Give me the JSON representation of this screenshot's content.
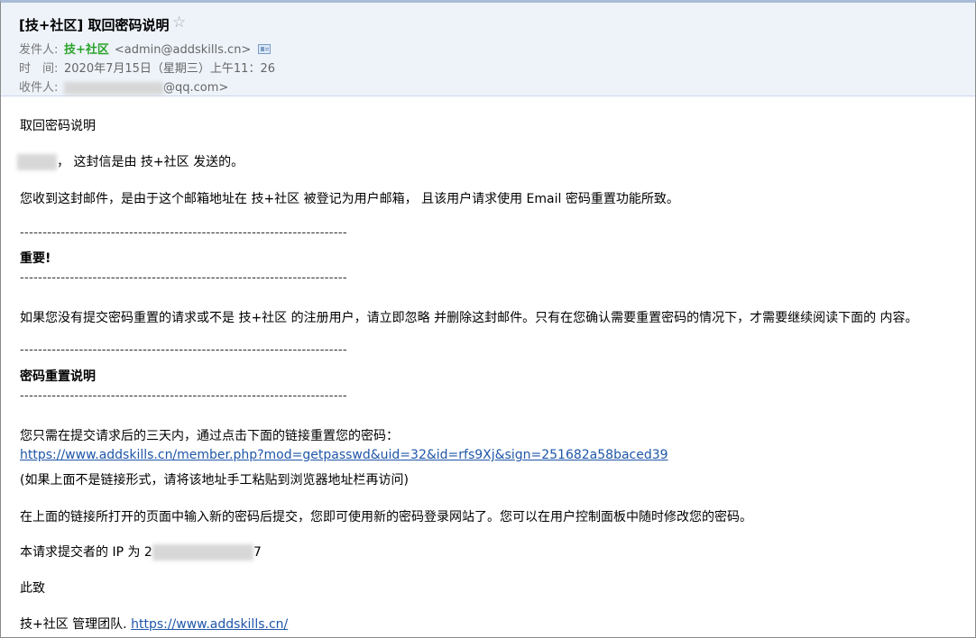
{
  "header": {
    "subject": "[技+社区] 取回密码说明",
    "star_icon": "star-outline-icon",
    "from_label": "发件人:",
    "from_name": "技+社区",
    "from_addr": "<admin@addskills.cn>",
    "card_icon": "address-card-icon",
    "time_label": "时　间:",
    "time_value": "2020年7月15日（星期三）上午11：26",
    "to_label": "收件人:",
    "to_suffix": "@qq.com>"
  },
  "body": {
    "title": "取回密码说明",
    "greeting_suffix": "， 这封信是由 技+社区 发送的。",
    "reason": "您收到这封邮件，是由于这个邮箱地址在 技+社区 被登记为用户邮箱， 且该用户请求使用 Email 密码重置功能所致。",
    "divider": "------------------------------------------------------------------------",
    "important_heading": "重要!",
    "warning": "如果您没有提交密码重置的请求或不是 技+社区 的注册用户，请立即忽略 并删除这封邮件。只有在您确认需要重置密码的情况下，才需要继续阅读下面的 内容。",
    "reset_heading": "密码重置说明",
    "instruction": "您只需在提交请求后的三天内，通过点击下面的链接重置您的密码：",
    "reset_link": "https://www.addskills.cn/member.php?mod=getpasswd&uid=32&id=rfs9Xj&sign=251682a58baced39",
    "link_hint": "(如果上面不是链接形式，请将该地址手工粘贴到浏览器地址栏再访问)",
    "after_submit": "在上面的链接所打开的页面中输入新的密码后提交，您即可使用新的密码登录网站了。您可以在用户控制面板中随时修改您的密码。",
    "ip_prefix": "本请求提交者的 IP 为 2",
    "ip_suffix": "7",
    "closing": "此致",
    "signature": "技+社区 管理团队.",
    "signature_link": "https://www.addskills.cn/"
  },
  "colors": {
    "header_bg": "#eef3fa",
    "sender_name": "#2aa32a",
    "link": "#1e56a8"
  }
}
